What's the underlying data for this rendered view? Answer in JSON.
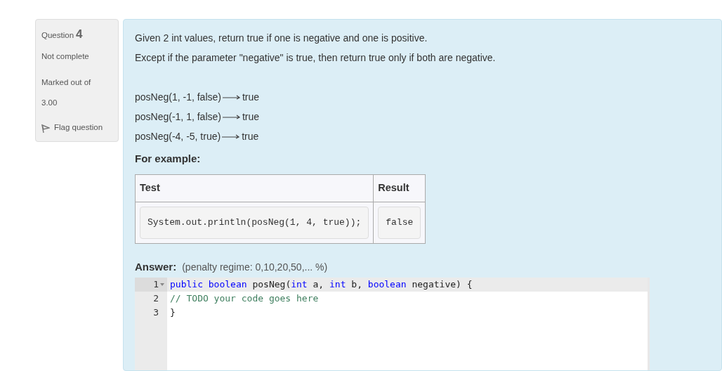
{
  "question_info": {
    "label": "Question",
    "number": "4",
    "status": "Not complete",
    "marked_label": "Marked out of",
    "mark": "3.00",
    "flag": {
      "label": "Flag question",
      "flagged": false
    }
  },
  "question_text": [
    "Given 2 int values, return true if one is negative and one is positive.",
    "Except if the parameter \"negative\" is true, then return true only if both are negative."
  ],
  "examples": [
    {
      "call": "posNeg(1, -1, false)",
      "result": "true"
    },
    {
      "call": "posNeg(-1, 1, false)",
      "result": "true"
    },
    {
      "call": "posNeg(-4, -5, true)",
      "result": "true"
    }
  ],
  "for_example_heading": "For example:",
  "example_table": {
    "columns": [
      "Test",
      "Result"
    ],
    "rows": [
      [
        "System.out.println(posNeg(1, 4, true));",
        "false"
      ]
    ]
  },
  "answer": {
    "label": "Answer:",
    "penalty": "(penalty regime: 0,10,20,50,... %)"
  },
  "editor": {
    "lines": [
      {
        "number": "1",
        "foldable": true,
        "active": true,
        "tokens": [
          {
            "kind": "keyword",
            "text": "public"
          },
          {
            "kind": "keyword",
            "text": " boolean"
          },
          {
            "kind": "plain",
            "text": " posNeg("
          },
          {
            "kind": "keyword",
            "text": "int"
          },
          {
            "kind": "plain",
            "text": " a, "
          },
          {
            "kind": "keyword",
            "text": "int"
          },
          {
            "kind": "plain",
            "text": " b, "
          },
          {
            "kind": "keyword",
            "text": "boolean"
          },
          {
            "kind": "plain",
            "text": " negative) {"
          }
        ]
      },
      {
        "number": "2",
        "foldable": false,
        "active": false,
        "tokens": [
          {
            "kind": "comment",
            "text": "// TODO your code goes here"
          }
        ]
      },
      {
        "number": "3",
        "foldable": false,
        "active": false,
        "tokens": [
          {
            "kind": "plain",
            "text": "}"
          }
        ]
      }
    ]
  }
}
